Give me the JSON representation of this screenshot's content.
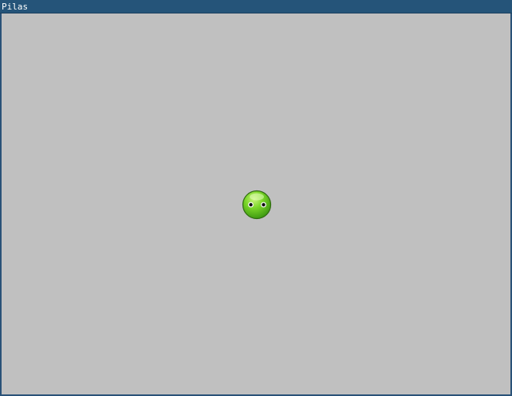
{
  "window": {
    "title": "Pilas",
    "title_bar_color": "#255479",
    "border_color": "#2a5278",
    "title_text_color": "#ffffff"
  },
  "canvas": {
    "background_color": "#c0c0c0"
  },
  "actor": {
    "icon": "green-ball-face-icon",
    "colors": {
      "body": "#6fcf1f",
      "highlight": "#c8f47a",
      "outline": "#2f6a10",
      "eye_white": "#ffffff",
      "eye_pupil": "#111111"
    }
  }
}
